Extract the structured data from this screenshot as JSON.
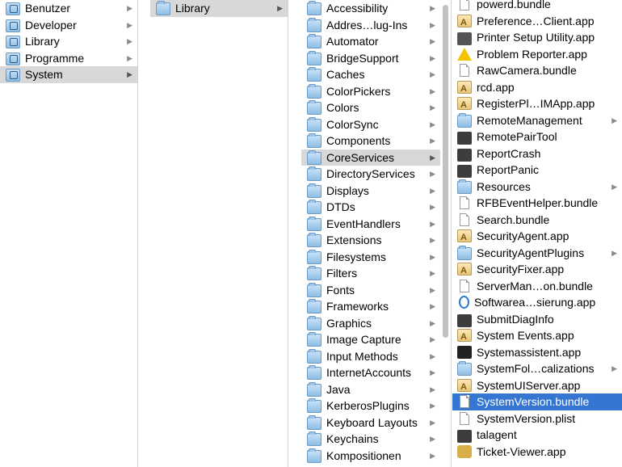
{
  "columns": [
    {
      "id": "col1",
      "items": [
        {
          "label": "Benutzer",
          "icon": "users-folder-icon",
          "arrow": true
        },
        {
          "label": "Developer",
          "icon": "developer-folder-icon",
          "arrow": true
        },
        {
          "label": "Library",
          "icon": "library-folder-icon",
          "arrow": true
        },
        {
          "label": "Programme",
          "icon": "applications-folder-icon",
          "arrow": true
        },
        {
          "label": "System",
          "icon": "system-folder-icon",
          "arrow": true,
          "selected": "grey"
        }
      ]
    },
    {
      "id": "col2",
      "items": [
        {
          "label": "Library",
          "icon": "folder-icon",
          "arrow": true,
          "selected": "grey"
        }
      ]
    },
    {
      "id": "col3",
      "items": [
        {
          "label": "Accessibility",
          "icon": "folder-icon",
          "arrow": true
        },
        {
          "label": "Addres…lug-Ins",
          "icon": "folder-icon",
          "arrow": true
        },
        {
          "label": "Automator",
          "icon": "folder-icon",
          "arrow": true
        },
        {
          "label": "BridgeSupport",
          "icon": "folder-icon",
          "arrow": true
        },
        {
          "label": "Caches",
          "icon": "folder-icon",
          "arrow": true
        },
        {
          "label": "ColorPickers",
          "icon": "folder-icon",
          "arrow": true
        },
        {
          "label": "Colors",
          "icon": "folder-icon",
          "arrow": true
        },
        {
          "label": "ColorSync",
          "icon": "folder-icon",
          "arrow": true
        },
        {
          "label": "Components",
          "icon": "folder-icon",
          "arrow": true
        },
        {
          "label": "CoreServices",
          "icon": "folder-icon",
          "arrow": true,
          "selected": "grey"
        },
        {
          "label": "DirectoryServices",
          "icon": "folder-icon",
          "arrow": true
        },
        {
          "label": "Displays",
          "icon": "folder-icon",
          "arrow": true
        },
        {
          "label": "DTDs",
          "icon": "folder-icon",
          "arrow": true
        },
        {
          "label": "EventHandlers",
          "icon": "folder-icon",
          "arrow": true
        },
        {
          "label": "Extensions",
          "icon": "folder-icon",
          "arrow": true
        },
        {
          "label": "Filesystems",
          "icon": "folder-icon",
          "arrow": true
        },
        {
          "label": "Filters",
          "icon": "folder-icon",
          "arrow": true
        },
        {
          "label": "Fonts",
          "icon": "folder-icon",
          "arrow": true
        },
        {
          "label": "Frameworks",
          "icon": "folder-icon",
          "arrow": true
        },
        {
          "label": "Graphics",
          "icon": "folder-icon",
          "arrow": true
        },
        {
          "label": "Image Capture",
          "icon": "folder-icon",
          "arrow": true
        },
        {
          "label": "Input Methods",
          "icon": "folder-icon",
          "arrow": true
        },
        {
          "label": "InternetAccounts",
          "icon": "folder-icon",
          "arrow": true
        },
        {
          "label": "Java",
          "icon": "folder-icon",
          "arrow": true
        },
        {
          "label": "KerberosPlugins",
          "icon": "folder-icon",
          "arrow": true
        },
        {
          "label": "Keyboard Layouts",
          "icon": "folder-icon",
          "arrow": true
        },
        {
          "label": "Keychains",
          "icon": "folder-icon",
          "arrow": true
        },
        {
          "label": "Kompositionen",
          "icon": "folder-icon",
          "arrow": true
        }
      ]
    },
    {
      "id": "col4",
      "items": [
        {
          "label": "powerd.bundle",
          "icon": "document-icon",
          "arrow": false
        },
        {
          "label": "Preference…Client.app",
          "icon": "app-icon",
          "arrow": false
        },
        {
          "label": "Printer Setup Utility.app",
          "icon": "printer-icon",
          "arrow": false
        },
        {
          "label": "Problem Reporter.app",
          "icon": "warning-icon",
          "arrow": false
        },
        {
          "label": "RawCamera.bundle",
          "icon": "document-icon",
          "arrow": false
        },
        {
          "label": "rcd.app",
          "icon": "app-icon",
          "arrow": false
        },
        {
          "label": "RegisterPl…IMApp.app",
          "icon": "app-icon",
          "arrow": false
        },
        {
          "label": "RemoteManagement",
          "icon": "folder-icon",
          "arrow": true
        },
        {
          "label": "RemotePairTool",
          "icon": "executable-icon",
          "arrow": false
        },
        {
          "label": "ReportCrash",
          "icon": "executable-icon",
          "arrow": false
        },
        {
          "label": "ReportPanic",
          "icon": "executable-icon",
          "arrow": false
        },
        {
          "label": "Resources",
          "icon": "folder-icon",
          "arrow": true
        },
        {
          "label": "RFBEventHelper.bundle",
          "icon": "document-icon",
          "arrow": false
        },
        {
          "label": "Search.bundle",
          "icon": "document-icon",
          "arrow": false
        },
        {
          "label": "SecurityAgent.app",
          "icon": "app-icon",
          "arrow": false
        },
        {
          "label": "SecurityAgentPlugins",
          "icon": "folder-icon",
          "arrow": true
        },
        {
          "label": "SecurityFixer.app",
          "icon": "app-icon",
          "arrow": false
        },
        {
          "label": "ServerMan…on.bundle",
          "icon": "document-icon",
          "arrow": false
        },
        {
          "label": "Softwarea…sierung.app",
          "icon": "software-update-icon",
          "arrow": false
        },
        {
          "label": "SubmitDiagInfo",
          "icon": "executable-icon",
          "arrow": false
        },
        {
          "label": "System Events.app",
          "icon": "app-icon",
          "arrow": false
        },
        {
          "label": "Systemassistent.app",
          "icon": "system-assistant-icon",
          "arrow": false
        },
        {
          "label": "SystemFol…calizations",
          "icon": "folder-icon",
          "arrow": true
        },
        {
          "label": "SystemUIServer.app",
          "icon": "app-icon",
          "arrow": false
        },
        {
          "label": "SystemVersion.bundle",
          "icon": "document-icon",
          "arrow": false,
          "selected": "blue"
        },
        {
          "label": "SystemVersion.plist",
          "icon": "document-icon",
          "arrow": false
        },
        {
          "label": "talagent",
          "icon": "executable-icon",
          "arrow": false
        },
        {
          "label": "Ticket-Viewer.app",
          "icon": "ticket-viewer-icon",
          "arrow": false
        }
      ]
    }
  ],
  "colors": {
    "selection_blue": "#3476d2",
    "selection_grey": "#d8d8d8",
    "divider": "#d4d4d4"
  }
}
